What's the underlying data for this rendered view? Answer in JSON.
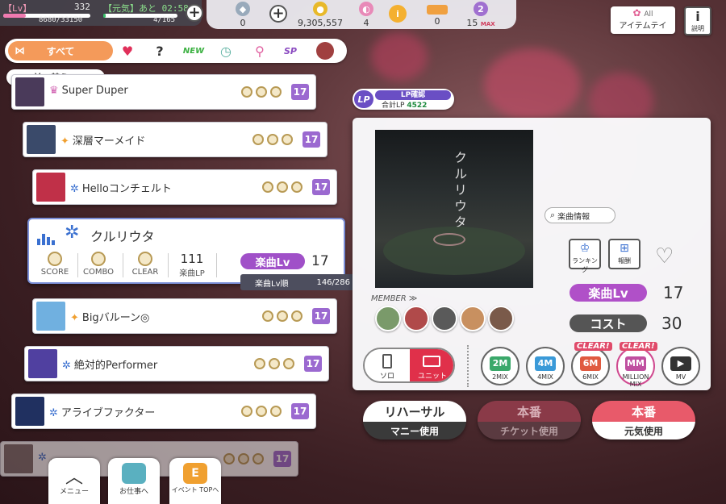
{
  "status": {
    "lv_label": "【Lv】",
    "lv_value": "332",
    "exp": "8680/33150",
    "exp_progress": 0.26,
    "genki_label": "【元気】あと 02:58",
    "genki_value": "4/165",
    "genki_progress": 0.03
  },
  "resources": [
    {
      "icon": "diamond-icon",
      "value": "0",
      "color": "#9ab"
    },
    {
      "icon": "coin-icon",
      "value": "9,305,557",
      "color": "#e8b92a"
    },
    {
      "icon": "pink-gem-icon",
      "value": "4",
      "color": "#e88ab8"
    },
    {
      "icon": "ticket-icon",
      "value": "0",
      "color": "#f0a040"
    },
    {
      "icon": "stamina-icon",
      "value": "15",
      "max": "MAX",
      "color": "#a070d0"
    }
  ],
  "corner": {
    "items_label": "アイテムテイ",
    "items_sub": "All",
    "help_label": "説明"
  },
  "filter": {
    "all_label": "すべて",
    "icons": [
      "heart-icon",
      "question-icon",
      "new-icon",
      "history-icon",
      "mic-icon",
      "sp-icon",
      "character-icon"
    ],
    "new_label": "NEW",
    "sp_label": "SP",
    "question_label": "?"
  },
  "sort": {
    "label": "並べ替え"
  },
  "songs": [
    {
      "name": "Super Duper",
      "mark": "♛",
      "mark_color": "#d060b0",
      "lv": "17",
      "thumb": "#4a3a5a"
    },
    {
      "name": "深層マーメイド",
      "mark": "✦",
      "mark_color": "#f0a030",
      "lv": "17",
      "thumb": "#3a4a6a"
    },
    {
      "name": "Helloコンチェルト",
      "mark": "✲",
      "mark_color": "#3a70d0",
      "lv": "17",
      "thumb": "#c03048"
    },
    {
      "name": "Bigバルーン◎",
      "mark": "✦",
      "mark_color": "#f0a030",
      "lv": "17",
      "thumb": "#70b0e0"
    },
    {
      "name": "絶対的Performer",
      "mark": "✲",
      "mark_color": "#3a70d0",
      "lv": "17",
      "thumb": "#5040a0"
    },
    {
      "name": "アライブファクター",
      "mark": "✲",
      "mark_color": "#3a70d0",
      "lv": "17",
      "thumb": "#203060"
    },
    {
      "name": "...",
      "mark": "✲",
      "mark_color": "#3a70d0",
      "lv": "17",
      "thumb": "#807070"
    }
  ],
  "selected": {
    "name": "クルリウタ",
    "mark": "✲",
    "score_label": "SCORE",
    "combo_label": "COMBO",
    "clear_label": "CLEAR",
    "lp_value": "111",
    "lp_label": "楽曲LP",
    "lv_label": "楽曲Lv",
    "lv_value": "17",
    "rank_label": "楽曲Lv順",
    "rank_value": "146/286"
  },
  "lp": {
    "title": "LP確認",
    "total_label": "合計LP",
    "total_value": "4522",
    "tag": "LP"
  },
  "info": {
    "song_info": "楽曲情報",
    "ranking": "ランキング",
    "reward": "報酬",
    "lv_label": "楽曲Lv",
    "lv_value": "17",
    "cost_label": "コスト",
    "cost_value": "30",
    "member_label": "MEMBER ≫",
    "jacket_title": "クルリウタ"
  },
  "members": [
    "#7a9a6a",
    "#b04a4a",
    "#5a5a5a",
    "#c89060",
    "#7a5a4a"
  ],
  "mode": {
    "solo": "ソロ",
    "unit": "ユニット"
  },
  "mix": [
    {
      "top": "2M",
      "sub": "2MIX",
      "color": "#3aa86a",
      "clear": ""
    },
    {
      "top": "4M",
      "sub": "4MIX",
      "color": "#3a9ad8",
      "clear": ""
    },
    {
      "top": "6M",
      "sub": "6MIX",
      "color": "#e05a40",
      "clear": "CLEAR!"
    },
    {
      "top": "MM",
      "sub": "MILLION MIX",
      "color": "#c050a0",
      "clear": "CLEAR!"
    },
    {
      "top": "▶",
      "sub": "MV",
      "color": "#333333",
      "clear": ""
    }
  ],
  "actions": [
    {
      "top": "リハーサル",
      "bottom": "マニー使用"
    },
    {
      "top": "本番",
      "bottom": "チケット使用"
    },
    {
      "top": "本番",
      "bottom": "元気使用"
    }
  ],
  "bottom_nav": [
    {
      "label": "メニュー"
    },
    {
      "label": "お仕事へ"
    },
    {
      "label": "イベント TOPへ"
    }
  ]
}
